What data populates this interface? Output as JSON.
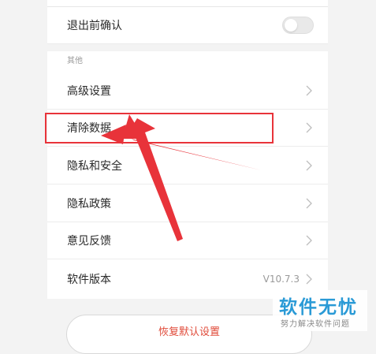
{
  "settings": {
    "exit_confirm": {
      "label": "退出前确认",
      "toggle_on": false
    },
    "section_other": "其他",
    "items": [
      {
        "label": "高级设置"
      },
      {
        "label": "清除数据"
      },
      {
        "label": "隐私和安全"
      },
      {
        "label": "隐私政策"
      },
      {
        "label": "意见反馈"
      },
      {
        "label": "软件版本",
        "value": "V10.7.3"
      }
    ],
    "restore_button": "恢复默认设置"
  },
  "watermark": {
    "title": "软件无忧",
    "subtitle": "努力解决软件问题"
  },
  "colors": {
    "annotation": "#e8333a",
    "restore_text": "#e04b3a",
    "watermark": "#2a9ad6"
  }
}
